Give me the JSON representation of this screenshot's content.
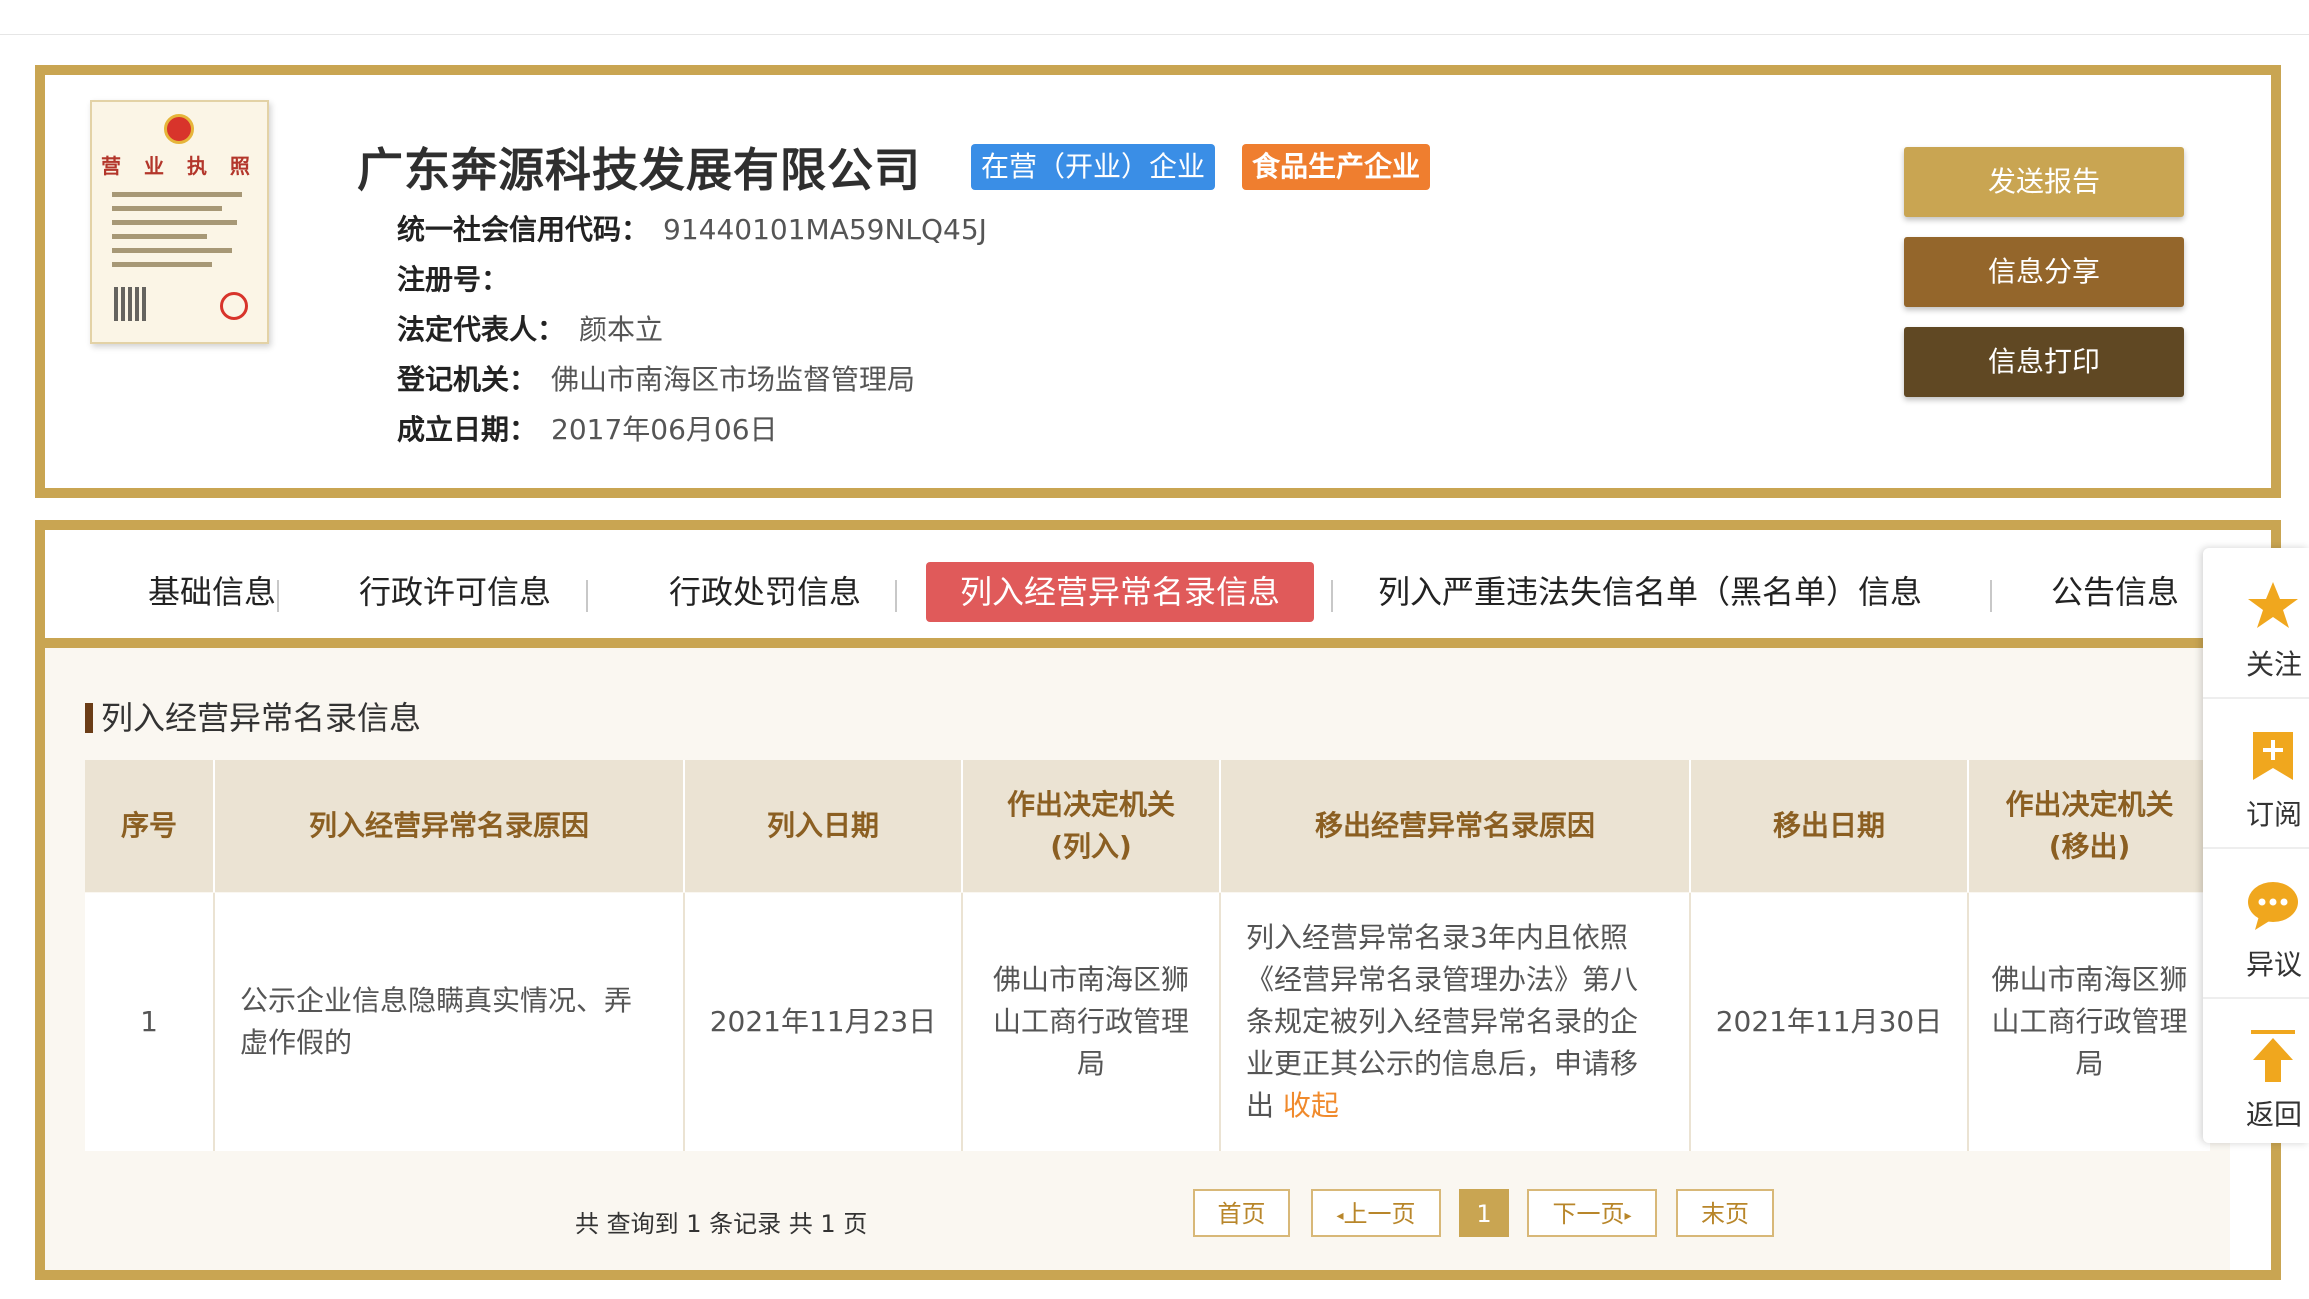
{
  "company": {
    "name": "广东奔源科技发展有限公司",
    "status_badge": "在营（开业）企业",
    "category_badge": "食品生产企业",
    "license_title": "营 业 执 照"
  },
  "info": [
    {
      "label": "统一社会信用代码：",
      "value": "91440101MA59NLQ45J"
    },
    {
      "label": "注册号：",
      "value": ""
    },
    {
      "label": "法定代表人：",
      "value": "颜本立"
    },
    {
      "label": "登记机关：",
      "value": "佛山市南海区市场监督管理局"
    },
    {
      "label": "成立日期：",
      "value": "2017年06月06日"
    }
  ],
  "actions": {
    "report": "发送报告",
    "share": "信息分享",
    "print": "信息打印"
  },
  "tabs": [
    {
      "label": "基础信息",
      "active": false
    },
    {
      "label": "行政许可信息",
      "active": false
    },
    {
      "label": "行政处罚信息",
      "active": false
    },
    {
      "label": "列入经营异常名录信息",
      "active": true
    },
    {
      "label": "列入严重违法失信名单（黑名单）信息",
      "active": false
    },
    {
      "label": "公告信息",
      "active": false
    }
  ],
  "section_title": "列入经营异常名录信息",
  "table": {
    "headers": [
      "序号",
      "列入经营异常名录原因",
      "列入日期",
      "作出决定机关(列入)",
      "移出经营异常名录原因",
      "移出日期",
      "作出决定机关(移出)"
    ],
    "rows": [
      {
        "index": "1",
        "reason_in": "公示企业信息隐瞒真实情况、弄虚作假的",
        "date_in": "2021年11月23日",
        "authority_in": "佛山市南海区狮山工商行政管理局",
        "reason_out": "列入经营异常名录3年内且依照《经营异常名录管理办法》第八条规定被列入经营异常名录的企业更正其公示的信息后，申请移出",
        "reason_out_toggle": "收起",
        "date_out": "2021年11月30日",
        "authority_out": "佛山市南海区狮山工商行政管理局"
      }
    ]
  },
  "pagination": {
    "summary": "共 查询到 1 条记录 共 1 页",
    "first": "首页",
    "prev": "上一页",
    "current": "1",
    "next": "下一页",
    "last": "末页"
  },
  "float_menu": {
    "follow": "关注",
    "subscribe": "订阅",
    "objection": "异议",
    "back": "返回"
  },
  "colors": {
    "gold": "#c9a552",
    "brown": "#94662b",
    "dark_brown": "#604823",
    "active_tab": "#e05a5a",
    "status_blue": "#3a8ee6",
    "food_orange": "#ef7e2f"
  }
}
